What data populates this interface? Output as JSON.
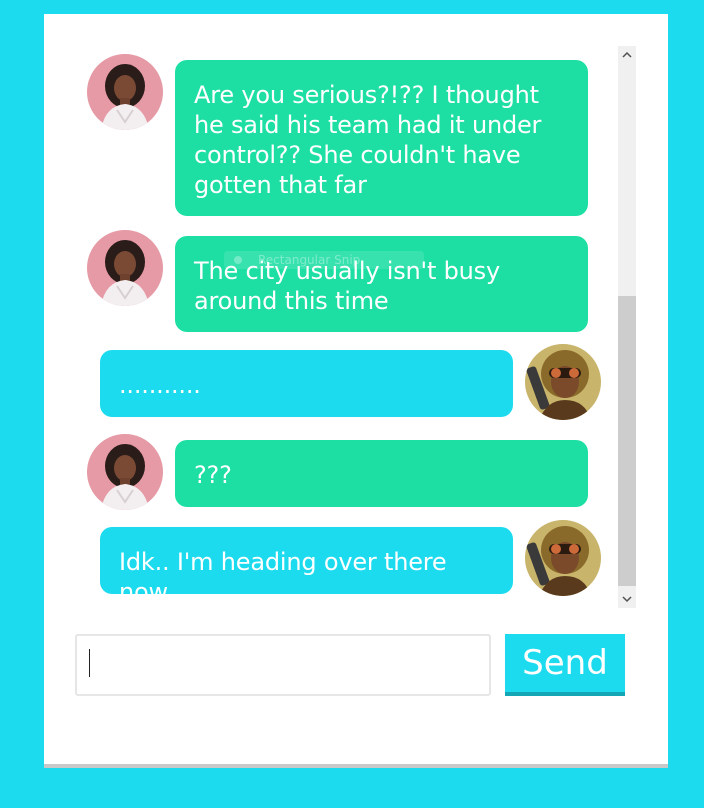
{
  "colors": {
    "page_background": "#1cdbee",
    "card_background": "#ffffff",
    "incoming_bubble": "#1ddfa3",
    "outgoing_bubble": "#1cdbee",
    "send_button": "#1cdbee",
    "bubble_text": "#ffffff"
  },
  "messages": [
    {
      "sender": "contact",
      "avatar": "woman-portrait-avatar",
      "text": "Are you serious?!?? I thought he said his team had it under control?? She couldn't have gotten that far"
    },
    {
      "sender": "contact",
      "avatar": "woman-portrait-avatar",
      "text": "The city usually isn't busy around this time"
    },
    {
      "sender": "me",
      "avatar": "goggles-character-avatar",
      "text": "..........."
    },
    {
      "sender": "contact",
      "avatar": "woman-portrait-avatar",
      "text": "???"
    },
    {
      "sender": "me",
      "avatar": "goggles-character-avatar",
      "text": "Idk.. I'm heading over there now."
    }
  ],
  "overlay": {
    "snip_label": "Rectangular Snip"
  },
  "scrollbar": {
    "up_icon": "chevron-up-icon",
    "down_icon": "chevron-down-icon"
  },
  "composer": {
    "input_value": "",
    "input_placeholder": "",
    "send_label": "Send"
  }
}
